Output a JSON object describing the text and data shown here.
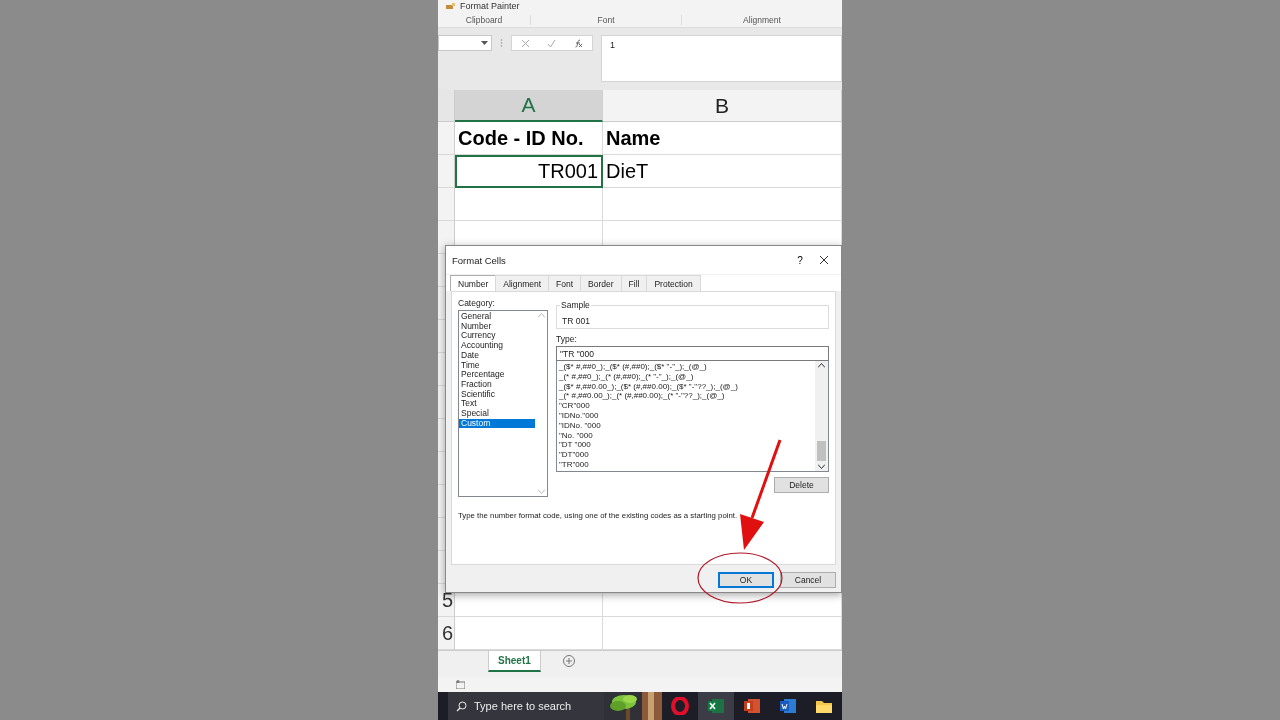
{
  "ribbon": {
    "button": "Format Painter",
    "groups": [
      "Clipboard",
      "Font",
      "Alignment"
    ]
  },
  "formula_bar": {
    "formula": "1"
  },
  "columns": [
    {
      "label": "A",
      "selected": true
    },
    {
      "label": "B",
      "selected": false
    }
  ],
  "rows": [
    {
      "cells": [
        {
          "text": "Code - ID No.",
          "bold": true,
          "kind": "text",
          "selected": false
        },
        {
          "text": "Name",
          "bold": true,
          "kind": "text",
          "selected": false
        }
      ]
    },
    {
      "cells": [
        {
          "text": "TR001",
          "bold": false,
          "kind": "number",
          "selected": true
        },
        {
          "text": "DieT",
          "bold": false,
          "kind": "text",
          "selected": false
        }
      ]
    }
  ],
  "row_numbers": [
    "5",
    "6"
  ],
  "dialog": {
    "title": "Format Cells",
    "help": "?",
    "tabs": [
      {
        "label": "Number",
        "selected": true
      },
      {
        "label": "Alignment",
        "selected": false
      },
      {
        "label": "Font",
        "selected": false
      },
      {
        "label": "Border",
        "selected": false
      },
      {
        "label": "Fill",
        "selected": false
      },
      {
        "label": "Protection",
        "selected": false
      }
    ],
    "category_label": "Category:",
    "categories": [
      {
        "label": "General",
        "selected": false
      },
      {
        "label": "Number",
        "selected": false
      },
      {
        "label": "Currency",
        "selected": false
      },
      {
        "label": "Accounting",
        "selected": false
      },
      {
        "label": "Date",
        "selected": false
      },
      {
        "label": "Time",
        "selected": false
      },
      {
        "label": "Percentage",
        "selected": false
      },
      {
        "label": "Fraction",
        "selected": false
      },
      {
        "label": "Scientific",
        "selected": false
      },
      {
        "label": "Text",
        "selected": false
      },
      {
        "label": "Special",
        "selected": false
      },
      {
        "label": "Custom",
        "selected": true
      }
    ],
    "sample_label": "Sample",
    "sample": "TR 001",
    "type_label": "Type:",
    "type_value": "\"TR \"000",
    "formats": [
      "_($* #,##0_);_($* (#,##0);_($* \"-\"_);_(@_)",
      "_(* #,##0_);_(* (#,##0);_(* \"-\"_);_(@_)",
      "_($* #,##0.00_);_($* (#,##0.00);_($* \"-\"??_);_(@_)",
      "_(* #,##0.00_);_(* (#,##0.00);_(* \"-\"??_);_(@_)",
      "\"CR\"000",
      "\"IDNo.\"000",
      "\"IDNo. \"000",
      "\"No. \"000",
      "\"DT \"000",
      "\"DT\"000",
      "\"TR\"000"
    ],
    "delete": "Delete",
    "hint": "Type the number format code, using one of the existing codes as a starting point.",
    "buttons": [
      {
        "label": "OK",
        "default": true
      },
      {
        "label": "Cancel",
        "default": false
      }
    ]
  },
  "sheet_tabs": [
    {
      "label": "Sheet1",
      "selected": true
    }
  ],
  "taskbar": {
    "search_placeholder": "Type here to search",
    "apps": [
      {
        "kind": "opera",
        "selected": false
      },
      {
        "kind": "excel",
        "selected": true
      },
      {
        "kind": "powerpoint",
        "selected": false
      },
      {
        "kind": "word",
        "selected": false
      },
      {
        "kind": "folder",
        "selected": false
      }
    ]
  }
}
